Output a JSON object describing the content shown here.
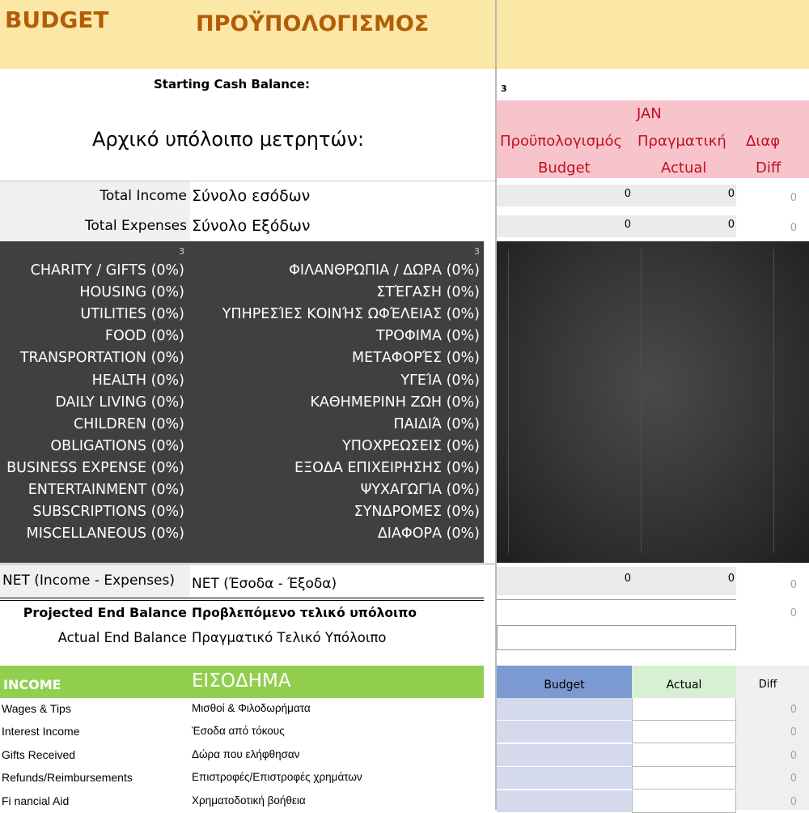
{
  "header": {
    "title_en": "BUDGET",
    "title_gr": "ΠΡΟΫΠΟΛΟΓΙΣΜΟΣ",
    "band_color": "#fce8a6",
    "title_color": "#b35d0a"
  },
  "starting_balance": {
    "label_en": "Starting Cash Balance:",
    "label_gr": "Αρχικό υπόλοιπο μετρητών:",
    "value": "3"
  },
  "month_header": {
    "month": "JAN",
    "col_budget_gr": "Προϋπολογισμός",
    "col_actual_gr": "Πραγματική",
    "col_diff_gr": "Διαφ",
    "col_budget_en": "Budget",
    "col_actual_en": "Actual",
    "col_diff_en": "Diff",
    "bg_color": "#f8c4cc",
    "text_color": "#c0101e"
  },
  "totals": [
    {
      "label_en": "Total Income",
      "label_gr": "Σύνολο εσόδων",
      "budget": "0",
      "actual": "0",
      "diff": "0"
    },
    {
      "label_en": "Total Expenses",
      "label_gr": "Σύνολο Εξόδων",
      "budget": "0",
      "actual": "0",
      "diff": "0"
    }
  ],
  "expenses": {
    "count_en": "3",
    "count_gr": "3",
    "categories": [
      {
        "en": "CHARITY / GIFTS (0%)",
        "gr": "ΦΙΛΑΝΘΡΩΠΙΑ / ΔΩΡΑ (0%)"
      },
      {
        "en": "HOUSING (0%)",
        "gr": "ΣΤΈΓΑΣΗ (0%)"
      },
      {
        "en": "UTILITIES (0%)",
        "gr": "ΥΠΗΡΕΣΊΕΣ ΚΟΙΝΉΣ ΩΦΈΛΕΙΑΣ (0%)"
      },
      {
        "en": "FOOD (0%)",
        "gr": "ΤΡΟΦΙΜΑ (0%)"
      },
      {
        "en": "TRANSPORTATION (0%)",
        "gr": "ΜΕΤΑΦΟΡΈΣ (0%)"
      },
      {
        "en": "HEALTH (0%)",
        "gr": "ΥΓΕΊΑ (0%)"
      },
      {
        "en": "DAILY LIVING (0%)",
        "gr": "ΚΑΘΗΜΕΡΙΝΗ ΖΩΗ (0%)"
      },
      {
        "en": "CHILDREN (0%)",
        "gr": "ΠΑΙΔΙΆ (0%)"
      },
      {
        "en": "OBLIGATIONS (0%)",
        "gr": "ΥΠΟΧΡΕΩΣΕΙΣ (0%)"
      },
      {
        "en": "BUSINESS EXPENSE (0%)",
        "gr": "ΕΞΟΔΑ ΕΠΙΧΕΙΡΗΣΗΣ (0%)"
      },
      {
        "en": "ENTERTAINMENT (0%)",
        "gr": "ΨΥΧΑΓΩΓΊΑ (0%)"
      },
      {
        "en": "SUBSCRIPTIONS (0%)",
        "gr": "ΣΥΝΔΡΟΜΕΣ (0%)"
      },
      {
        "en": "MISCELLANEOUS (0%)",
        "gr": "ΔΙΑΦΟΡΑ (0%)"
      }
    ]
  },
  "net": {
    "label_en": "NET (Income - Expenses)",
    "label_gr": "NET (Έσοδα - Έξοδα)",
    "budget": "0",
    "actual": "0",
    "diff": "0"
  },
  "projected": {
    "label_en": "Projected End Balance",
    "label_gr": "Προβλεπόμενο τελικό υπόλοιπο",
    "value": "0"
  },
  "actual_end": {
    "label_en": "Actual End Balance",
    "label_gr": "Πραγματικό Τελικό Υπόλοιπο",
    "value": ""
  },
  "income": {
    "title_en": "INCOME",
    "title_gr": "ΕΙΣΟΔΗΜΑ",
    "green_color": "#92cf4f",
    "col_budget": "Budget",
    "col_actual": "Actual",
    "col_diff": "Diff",
    "rows": [
      {
        "en": "Wages & Tips",
        "gr": "Μισθοί & Φιλοδωρήματα",
        "diff": "0"
      },
      {
        "en": "Interest Income",
        "gr": "Έσοδα από τόκους",
        "diff": "0"
      },
      {
        "en": "Gifts Received",
        "gr": "Δώρα που ελήφθησαν",
        "diff": "0"
      },
      {
        "en": "Refunds/Reimbursements",
        "gr": "Επιστροφές/Επιστροφές χρημάτων",
        "diff": "0"
      },
      {
        "en": "Fi nancial Aid",
        "gr": "Χρηματοδοτική βοήθεια",
        "diff": "0"
      }
    ]
  }
}
